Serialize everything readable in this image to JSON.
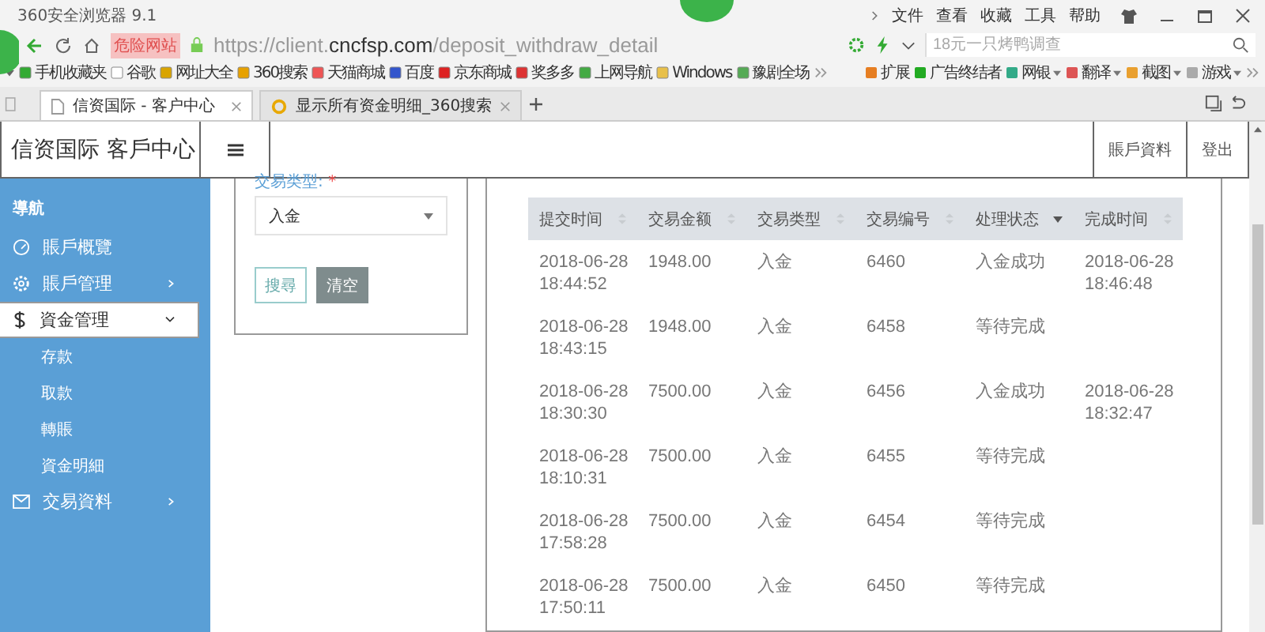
{
  "browser": {
    "title": "360安全浏览器 9.1",
    "menu": [
      "文件",
      "查看",
      "收藏",
      "工具",
      "帮助"
    ],
    "danger_badge": "危险网站",
    "url": {
      "start": "https://client.",
      "domain": "cncfsp.com",
      "path": "/deposit_withdraw_detail"
    },
    "search": {
      "placeholder": "18元一只烤鸭调查"
    },
    "bookmarks": [
      "手机收藏夹",
      "谷歌",
      "网址大全",
      "360搜索",
      "天猫商城",
      "百度",
      "京东商城",
      "奖多多",
      "上网导航",
      "Windows",
      "豫剧全场"
    ],
    "tools": [
      "扩展",
      "广告终结者",
      "网银",
      "翻译",
      "截图",
      "游戏"
    ],
    "tabs": [
      {
        "label": "信资国际 - 客户中心",
        "selected": true
      },
      {
        "label": "显示所有资金明细_360搜索",
        "selected": false
      }
    ]
  },
  "header": {
    "brand": "信资国际 客戶中心",
    "links": [
      "賬戶資料",
      "登出"
    ]
  },
  "sidebar": {
    "heading": "導航",
    "items": [
      {
        "label": "賬戶概覽",
        "selected": false
      },
      {
        "label": "賬戶管理",
        "selected": false,
        "expanded": false
      },
      {
        "label": "資金管理",
        "selected": true,
        "expanded": true,
        "children": [
          "存款",
          "取款",
          "轉賬",
          "資金明細"
        ]
      },
      {
        "label": "交易資料",
        "selected": false,
        "expanded": false
      }
    ]
  },
  "filter": {
    "label": "交易类型:",
    "required_mark": "*",
    "value": "入金",
    "buttons": [
      {
        "label": "搜尋",
        "kind": "outline"
      },
      {
        "label": "清空",
        "kind": "filled"
      }
    ]
  },
  "table": {
    "columns": [
      {
        "label": "提交时间",
        "sorted": false
      },
      {
        "label": "交易金额",
        "sorted": false
      },
      {
        "label": "交易类型",
        "sorted": false
      },
      {
        "label": "交易编号",
        "sorted": false
      },
      {
        "label": "处理状态",
        "sorted": true
      },
      {
        "label": "完成时间",
        "sorted": false
      }
    ],
    "rows": [
      [
        "2018-06-28 18:44:52",
        "1948.00",
        "入金",
        "6460",
        "入金成功",
        "2018-06-28 18:46:48"
      ],
      [
        "2018-06-28 18:43:15",
        "1948.00",
        "入金",
        "6458",
        "等待完成",
        ""
      ],
      [
        "2018-06-28 18:30:30",
        "7500.00",
        "入金",
        "6456",
        "入金成功",
        "2018-06-28 18:32:47"
      ],
      [
        "2018-06-28 18:10:31",
        "7500.00",
        "入金",
        "6455",
        "等待完成",
        ""
      ],
      [
        "2018-06-28 17:58:28",
        "7500.00",
        "入金",
        "6454",
        "等待完成",
        ""
      ],
      [
        "2018-06-28 17:50:11",
        "7500.00",
        "入金",
        "6450",
        "等待完成",
        ""
      ]
    ]
  }
}
